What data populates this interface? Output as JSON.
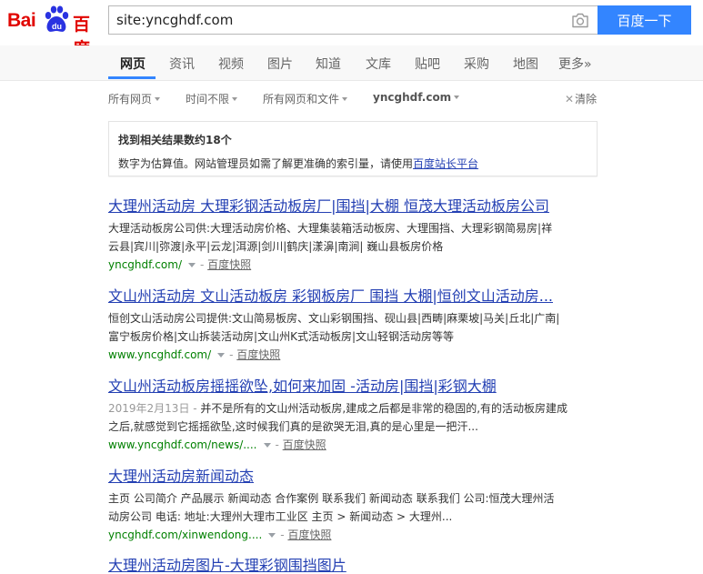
{
  "logo": {
    "left": "Bai",
    "right": "百度"
  },
  "search": {
    "query": "site:yncghdf.com",
    "button_label": "百度一下"
  },
  "tabs": [
    "网页",
    "资讯",
    "视频",
    "图片",
    "知道",
    "文库",
    "贴吧",
    "采购",
    "地图",
    "更多»"
  ],
  "filters": {
    "items": [
      "所有网页",
      "时间不限",
      "所有网页和文件",
      "yncghdf.com"
    ],
    "clear_label": "清除"
  },
  "info": {
    "count_text": "找到相关结果数约18个",
    "note_text": "数字为估算值。网站管理员如需了解更准确的索引量，请使用",
    "note_link": "百度站长平台"
  },
  "results": [
    {
      "title": "大理州活动房 大理彩钢活动板房厂|围挡|大棚 恒茂大理活动板房公司",
      "snippet_lines": [
        "大理活动板房公司供:大理活动房价格、大理集装箱活动板房、大理围挡、大理彩钢简易房|祥",
        "云县|宾川|弥渡|永平|云龙|洱源|剑川|鹤庆|漾濞|南涧| 巍山县板房价格"
      ],
      "url": "yncghdf.com/",
      "cache_label": "百度快照"
    },
    {
      "title": "文山州活动房 文山活动板房 彩钢板房厂 围挡 大棚|恒创文山活动房...",
      "snippet_lines": [
        "恒创文山活动房公司提供:文山简易板房、文山彩钢围挡、砚山县|西畴|麻栗坡|马关|丘北|广南|",
        "富宁板房价格|文山拆装活动房|文山州K式活动板房|文山轻钢活动房等等"
      ],
      "url": "www.yncghdf.com/",
      "cache_label": "百度快照"
    },
    {
      "title": "文山州活动板房摇摇欲坠,如何来加固 -活动房|围挡|彩钢大棚",
      "date": "2019年2月13日 - ",
      "snippet_lines": [
        "并不是所有的文山州活动板房,建成之后都是非常的稳固的,有的活动板房建成",
        "之后,就感觉到它摇摇欲坠,这时候我们真的是欲哭无泪,真的是心里是一把汗..."
      ],
      "url": "www.yncghdf.com/news/....",
      "cache_label": "百度快照"
    },
    {
      "title": "大理州活动房新闻动态",
      "snippet_lines": [
        "主页 公司简介 产品展示 新闻动态 合作案例 联系我们 新闻动态 联系我们 公司:恒茂大理州活",
        "动房公司 电话: 地址:大理州大理市工业区 主页 > 新闻动态 > 大理州..."
      ],
      "url": "yncghdf.com/xinwendong....",
      "cache_label": "百度快照"
    },
    {
      "title": "大理州活动房图片-大理彩钢围挡图片"
    }
  ],
  "colors": {
    "brand_red": "#e10602",
    "brand_blue": "#2932e1",
    "button_blue": "#3385ff",
    "link_blue": "#2440b3",
    "url_green": "#008000"
  },
  "icons": [
    "baidu-paw-icon",
    "camera-icon",
    "caret-down-icon",
    "clear-x-icon"
  ]
}
